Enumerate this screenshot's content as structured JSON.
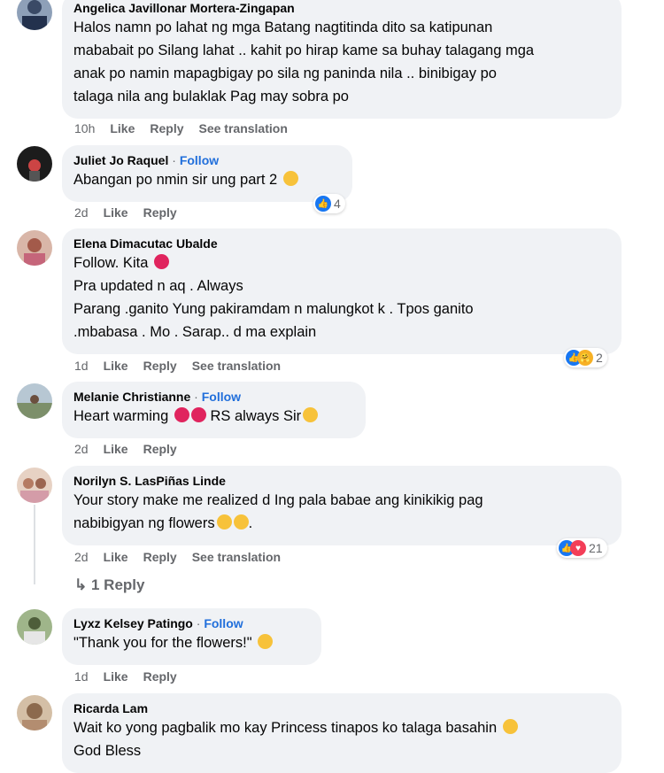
{
  "comments": [
    {
      "name": "Angelica Javillonar Mortera-Zingapan",
      "lines": [
        "Halos namn po lahat ng mga Batang nagtitinda dito sa katipunan",
        "mababait po Silang lahat .. kahit po hirap kame sa buhay talagang mga",
        "anak po namin mapagbigay po sila ng paninda nila .. binibigay po",
        "talaga nila ang bulaklak Pag may sobra po"
      ],
      "time": "10h",
      "like": "Like",
      "reply": "Reply",
      "translate": "See translation"
    },
    {
      "name": "Juliet Jo Raquel",
      "follow": "Follow",
      "lines": [
        "Abangan po nmin sir ung part 2"
      ],
      "time": "2d",
      "like": "Like",
      "reply": "Reply",
      "reactions": "4"
    },
    {
      "name": "Elena Dimacutac Ubalde",
      "lines": [
        "Follow. Kita",
        "Pra updated n aq . Always",
        "Parang .ganito Yung pakiramdam n malungkot k . Tpos ganito",
        ".mbabasa . Mo . Sarap.. d ma explain"
      ],
      "time": "1d",
      "like": "Like",
      "reply": "Reply",
      "translate": "See translation",
      "reactions": "2"
    },
    {
      "name": "Melanie Christianne",
      "follow": "Follow",
      "lines": [
        "Heart warming",
        "RS always Sir"
      ],
      "time": "2d",
      "like": "Like",
      "reply": "Reply"
    },
    {
      "name": "Norilyn S. LasPiñas Linde",
      "lines": [
        "Your story make me realized d Ing pala babae ang kinikikig pag",
        "nabibigyan ng flowers"
      ],
      "time": "2d",
      "like": "Like",
      "reply": "Reply",
      "translate": "See translation",
      "reactions": "21",
      "replies": "1 Reply"
    },
    {
      "name": "Lyxz Kelsey Patingo",
      "follow": "Follow",
      "lines": [
        "\"Thank you for the flowers!\""
      ],
      "time": "1d",
      "like": "Like",
      "reply": "Reply"
    },
    {
      "name": "Ricarda Lam",
      "lines": [
        "Wait ko yong pagbalik mo kay Princess tinapos ko talaga basahin",
        "God Bless"
      ]
    }
  ],
  "colors": {
    "bubble": "#f0f2f5",
    "link": "#216fdb",
    "muted": "#65676b"
  }
}
